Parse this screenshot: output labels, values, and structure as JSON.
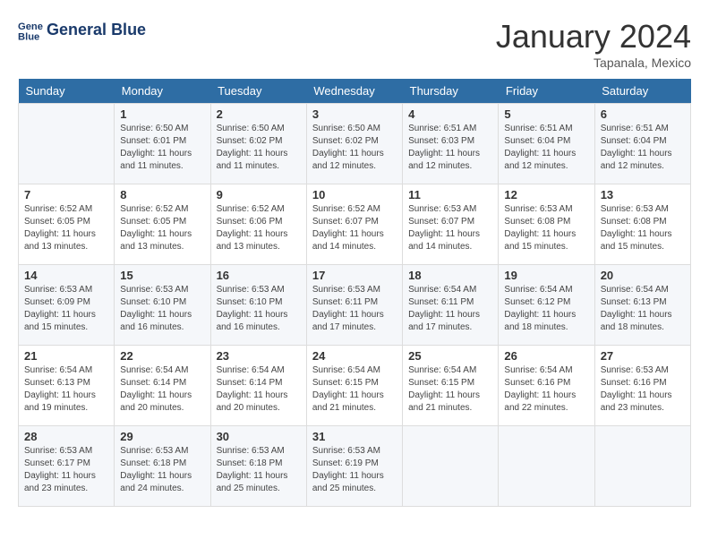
{
  "header": {
    "logo_line1": "General",
    "logo_line2": "Blue",
    "month_title": "January 2024",
    "location": "Tapanala, Mexico"
  },
  "weekdays": [
    "Sunday",
    "Monday",
    "Tuesday",
    "Wednesday",
    "Thursday",
    "Friday",
    "Saturday"
  ],
  "weeks": [
    [
      {
        "day": "",
        "sunrise": "",
        "sunset": "",
        "daylight": ""
      },
      {
        "day": "1",
        "sunrise": "Sunrise: 6:50 AM",
        "sunset": "Sunset: 6:01 PM",
        "daylight": "Daylight: 11 hours and 11 minutes."
      },
      {
        "day": "2",
        "sunrise": "Sunrise: 6:50 AM",
        "sunset": "Sunset: 6:02 PM",
        "daylight": "Daylight: 11 hours and 11 minutes."
      },
      {
        "day": "3",
        "sunrise": "Sunrise: 6:50 AM",
        "sunset": "Sunset: 6:02 PM",
        "daylight": "Daylight: 11 hours and 12 minutes."
      },
      {
        "day": "4",
        "sunrise": "Sunrise: 6:51 AM",
        "sunset": "Sunset: 6:03 PM",
        "daylight": "Daylight: 11 hours and 12 minutes."
      },
      {
        "day": "5",
        "sunrise": "Sunrise: 6:51 AM",
        "sunset": "Sunset: 6:04 PM",
        "daylight": "Daylight: 11 hours and 12 minutes."
      },
      {
        "day": "6",
        "sunrise": "Sunrise: 6:51 AM",
        "sunset": "Sunset: 6:04 PM",
        "daylight": "Daylight: 11 hours and 12 minutes."
      }
    ],
    [
      {
        "day": "7",
        "sunrise": "Sunrise: 6:52 AM",
        "sunset": "Sunset: 6:05 PM",
        "daylight": "Daylight: 11 hours and 13 minutes."
      },
      {
        "day": "8",
        "sunrise": "Sunrise: 6:52 AM",
        "sunset": "Sunset: 6:05 PM",
        "daylight": "Daylight: 11 hours and 13 minutes."
      },
      {
        "day": "9",
        "sunrise": "Sunrise: 6:52 AM",
        "sunset": "Sunset: 6:06 PM",
        "daylight": "Daylight: 11 hours and 13 minutes."
      },
      {
        "day": "10",
        "sunrise": "Sunrise: 6:52 AM",
        "sunset": "Sunset: 6:07 PM",
        "daylight": "Daylight: 11 hours and 14 minutes."
      },
      {
        "day": "11",
        "sunrise": "Sunrise: 6:53 AM",
        "sunset": "Sunset: 6:07 PM",
        "daylight": "Daylight: 11 hours and 14 minutes."
      },
      {
        "day": "12",
        "sunrise": "Sunrise: 6:53 AM",
        "sunset": "Sunset: 6:08 PM",
        "daylight": "Daylight: 11 hours and 15 minutes."
      },
      {
        "day": "13",
        "sunrise": "Sunrise: 6:53 AM",
        "sunset": "Sunset: 6:08 PM",
        "daylight": "Daylight: 11 hours and 15 minutes."
      }
    ],
    [
      {
        "day": "14",
        "sunrise": "Sunrise: 6:53 AM",
        "sunset": "Sunset: 6:09 PM",
        "daylight": "Daylight: 11 hours and 15 minutes."
      },
      {
        "day": "15",
        "sunrise": "Sunrise: 6:53 AM",
        "sunset": "Sunset: 6:10 PM",
        "daylight": "Daylight: 11 hours and 16 minutes."
      },
      {
        "day": "16",
        "sunrise": "Sunrise: 6:53 AM",
        "sunset": "Sunset: 6:10 PM",
        "daylight": "Daylight: 11 hours and 16 minutes."
      },
      {
        "day": "17",
        "sunrise": "Sunrise: 6:53 AM",
        "sunset": "Sunset: 6:11 PM",
        "daylight": "Daylight: 11 hours and 17 minutes."
      },
      {
        "day": "18",
        "sunrise": "Sunrise: 6:54 AM",
        "sunset": "Sunset: 6:11 PM",
        "daylight": "Daylight: 11 hours and 17 minutes."
      },
      {
        "day": "19",
        "sunrise": "Sunrise: 6:54 AM",
        "sunset": "Sunset: 6:12 PM",
        "daylight": "Daylight: 11 hours and 18 minutes."
      },
      {
        "day": "20",
        "sunrise": "Sunrise: 6:54 AM",
        "sunset": "Sunset: 6:13 PM",
        "daylight": "Daylight: 11 hours and 18 minutes."
      }
    ],
    [
      {
        "day": "21",
        "sunrise": "Sunrise: 6:54 AM",
        "sunset": "Sunset: 6:13 PM",
        "daylight": "Daylight: 11 hours and 19 minutes."
      },
      {
        "day": "22",
        "sunrise": "Sunrise: 6:54 AM",
        "sunset": "Sunset: 6:14 PM",
        "daylight": "Daylight: 11 hours and 20 minutes."
      },
      {
        "day": "23",
        "sunrise": "Sunrise: 6:54 AM",
        "sunset": "Sunset: 6:14 PM",
        "daylight": "Daylight: 11 hours and 20 minutes."
      },
      {
        "day": "24",
        "sunrise": "Sunrise: 6:54 AM",
        "sunset": "Sunset: 6:15 PM",
        "daylight": "Daylight: 11 hours and 21 minutes."
      },
      {
        "day": "25",
        "sunrise": "Sunrise: 6:54 AM",
        "sunset": "Sunset: 6:15 PM",
        "daylight": "Daylight: 11 hours and 21 minutes."
      },
      {
        "day": "26",
        "sunrise": "Sunrise: 6:54 AM",
        "sunset": "Sunset: 6:16 PM",
        "daylight": "Daylight: 11 hours and 22 minutes."
      },
      {
        "day": "27",
        "sunrise": "Sunrise: 6:53 AM",
        "sunset": "Sunset: 6:16 PM",
        "daylight": "Daylight: 11 hours and 23 minutes."
      }
    ],
    [
      {
        "day": "28",
        "sunrise": "Sunrise: 6:53 AM",
        "sunset": "Sunset: 6:17 PM",
        "daylight": "Daylight: 11 hours and 23 minutes."
      },
      {
        "day": "29",
        "sunrise": "Sunrise: 6:53 AM",
        "sunset": "Sunset: 6:18 PM",
        "daylight": "Daylight: 11 hours and 24 minutes."
      },
      {
        "day": "30",
        "sunrise": "Sunrise: 6:53 AM",
        "sunset": "Sunset: 6:18 PM",
        "daylight": "Daylight: 11 hours and 25 minutes."
      },
      {
        "day": "31",
        "sunrise": "Sunrise: 6:53 AM",
        "sunset": "Sunset: 6:19 PM",
        "daylight": "Daylight: 11 hours and 25 minutes."
      },
      {
        "day": "",
        "sunrise": "",
        "sunset": "",
        "daylight": ""
      },
      {
        "day": "",
        "sunrise": "",
        "sunset": "",
        "daylight": ""
      },
      {
        "day": "",
        "sunrise": "",
        "sunset": "",
        "daylight": ""
      }
    ]
  ]
}
